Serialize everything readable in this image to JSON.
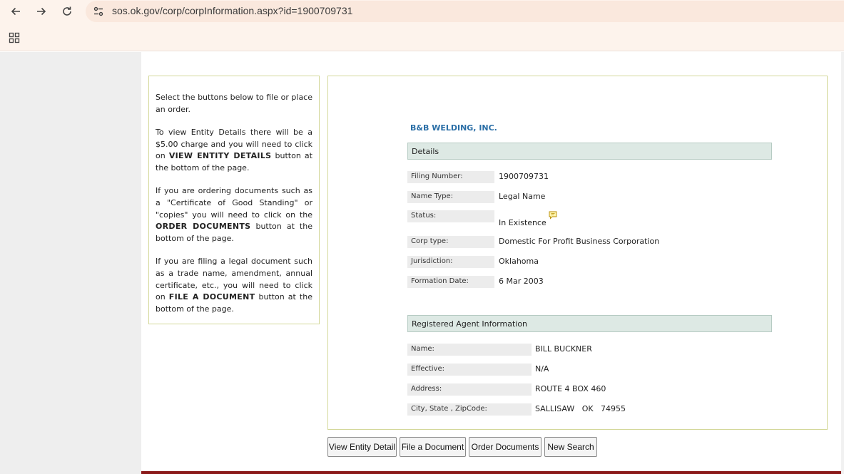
{
  "browser": {
    "url": "sos.ok.gov/corp/corpInformation.aspx?id=1900709731",
    "icons": {
      "back": "arrow-left-icon",
      "forward": "arrow-right-icon",
      "reload": "reload-icon",
      "site_info": "tune-icon",
      "apps": "apps-grid-icon"
    }
  },
  "sidebar_info": {
    "p1": "Select the buttons below to file or place an order.",
    "p2_before": "To view Entity Details there will be a $5.00 charge and you will need to click on ",
    "p2_bold": "VIEW ENTITY DETAILS",
    "p2_after": " button at the bottom of the page.",
    "p3_before": "If you are ordering documents such as a \"Certificate of Good Standing\" or \"copies\" you will need to click on the ",
    "p3_bold": "ORDER DOCUMENTS",
    "p3_after": " button at the bottom of the page.",
    "p4_before": "If you are filing a legal document such as a trade name, amendment, annual certificate, etc., you will need to click on ",
    "p4_bold": "FILE A DOCUMENT",
    "p4_after": " button at the bottom of the page."
  },
  "entity": {
    "name": "B&B WELDING, INC.",
    "details_heading": "Details",
    "details": [
      {
        "label": "Filing Number:",
        "value": "1900709731"
      },
      {
        "label": "Name Type:",
        "value": "Legal Name"
      },
      {
        "label": "Status:",
        "value": "In Existence"
      },
      {
        "label": "Corp type:",
        "value": "Domestic For Profit Business Corporation"
      },
      {
        "label": "Jurisdiction:",
        "value": "Oklahoma"
      },
      {
        "label": "Formation Date:",
        "value": "6 Mar 2003"
      }
    ],
    "agent_heading": "Registered Agent Information",
    "agent": [
      {
        "label": "Name:",
        "value": "BILL BUCKNER"
      },
      {
        "label": "Effective:",
        "value": "N/A"
      },
      {
        "label": "Address:",
        "value": "ROUTE 4 BOX 460"
      },
      {
        "label": "City, State , ZipCode:",
        "value": "SALLISAW   OK   74955"
      }
    ]
  },
  "buttons": {
    "view_entity": "View Entity Detail",
    "file_document": "File a Document",
    "order_documents": "Order Documents",
    "new_search": "New Search"
  },
  "colors": {
    "entity_name": "#2a6ea6",
    "section_header_bg": "#dde9e4",
    "box_border": "#d4d89a",
    "footer_bar": "#8b1a1a"
  }
}
